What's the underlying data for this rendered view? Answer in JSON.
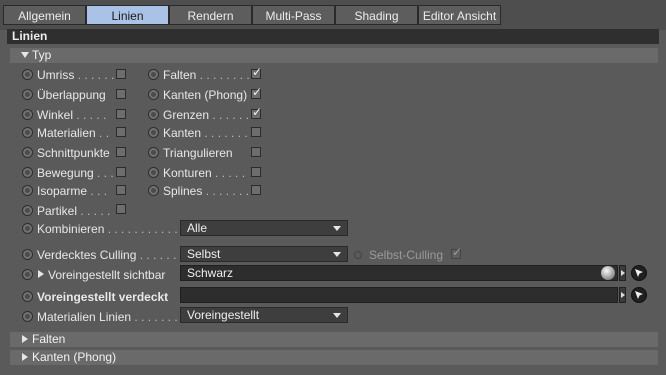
{
  "tabs": [
    {
      "label": "Allgemein",
      "active": false
    },
    {
      "label": "Linien",
      "active": true
    },
    {
      "label": "Rendern",
      "active": false
    },
    {
      "label": "Multi-Pass",
      "active": false
    },
    {
      "label": "Shading",
      "active": false
    },
    {
      "label": "Editor Ansicht",
      "active": false
    }
  ],
  "section_title": "Linien",
  "group_typ": {
    "label": "Typ",
    "expanded": true
  },
  "type_options_left": [
    {
      "label": "Umriss",
      "dots": " . . . . . .",
      "checked": false
    },
    {
      "label": "Überlappung",
      "dots": "",
      "checked": false
    },
    {
      "label": "Winkel",
      "dots": " . . . . .",
      "checked": false
    },
    {
      "label": "Materialien",
      "dots": " . .",
      "checked": false
    },
    {
      "label": "Schnittpunkte",
      "dots": "",
      "checked": false
    },
    {
      "label": "Bewegung",
      "dots": " . . .",
      "checked": false
    },
    {
      "label": "Isoparme",
      "dots": " . . .",
      "checked": false
    },
    {
      "label": "Partikel",
      "dots": " . . . . .",
      "checked": false
    }
  ],
  "type_options_right": [
    {
      "label": "Falten",
      "dots": " . . . . . . . .",
      "checked": true
    },
    {
      "label": "Kanten (Phong)",
      "dots": "",
      "checked": true
    },
    {
      "label": "Grenzen",
      "dots": " . . . . . .",
      "checked": true
    },
    {
      "label": "Kanten",
      "dots": " . . . . . . .",
      "checked": false
    },
    {
      "label": "Triangulieren",
      "dots": "",
      "checked": false
    },
    {
      "label": "Konturen",
      "dots": " . . . . .",
      "checked": false
    },
    {
      "label": "Splines",
      "dots": " . . . . . . .",
      "checked": false
    }
  ],
  "kombinieren": {
    "label": "Kombinieren",
    "dots": " . . . . . . . . . . . . .",
    "value": "Alle"
  },
  "culling": {
    "label": "Verdecktes Culling",
    "dots": " . . . . . .",
    "value": "Selbst",
    "selbst_culling_label": "Selbst-Culling",
    "selbst_culling_checked": true
  },
  "visible_default": {
    "label": "Voreingestellt sichtbar",
    "value": "Schwarz"
  },
  "hidden_default": {
    "label": "Voreingestellt verdeckt",
    "value": ""
  },
  "material_lines": {
    "label": "Materialien Linien",
    "dots": " . . . . . . . .",
    "value": "Voreingestellt"
  },
  "collapsed_groups": [
    {
      "label": "Falten"
    },
    {
      "label": "Kanten (Phong)"
    }
  ],
  "icons": {
    "pick": "arrow-pick-icon",
    "expand": "triangle-right-icon",
    "collapse": "triangle-down-icon",
    "texture": "shader-sphere-icon"
  },
  "colors": {
    "active_tab": "#a9c2e6",
    "panel": "#5a5a5a",
    "section": "#2f2f2f"
  }
}
